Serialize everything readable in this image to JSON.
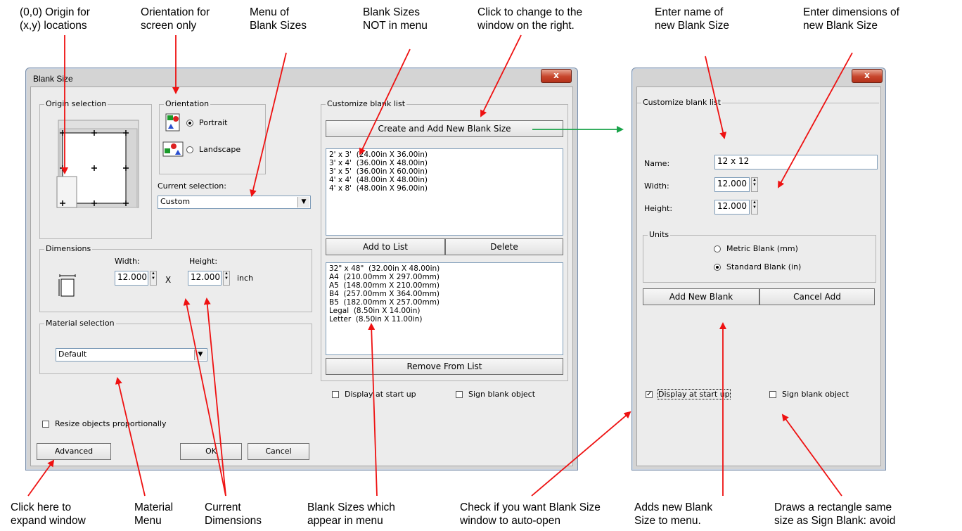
{
  "annotations_top": {
    "origin": "(0,0) Origin for\n(x,y) locations",
    "orientation": "Orientation for\nscreen only",
    "menu": "Menu of\nBlank Sizes",
    "not_in_menu": "Blank Sizes\nNOT in menu",
    "click_change": "Click to change to the\nwindow on the right.",
    "enter_name": "Enter name of\nnew Blank Size",
    "enter_dims": "Enter dimensions of\nnew Blank Size"
  },
  "annotations_bottom": {
    "expand": "Click here to\nexpand window",
    "material": "Material\nMenu",
    "current_dims": "Current\nDimensions",
    "in_menu": "Blank Sizes which\nappear in menu",
    "auto_open": "Check if you want Blank Size\nwindow to auto-open",
    "adds_new": "Adds new Blank\nSize to menu.",
    "draws_rect": "Draws a rectangle same\nsize as Sign Blank: avoid"
  },
  "dialog": {
    "title": "Blank Size",
    "close": "x",
    "origin_group": "Origin selection",
    "orientation_group": "Orientation",
    "portrait": "Portrait",
    "landscape": "Landscape",
    "current_selection_label": "Current selection:",
    "current_selection_value": "Custom",
    "dimensions_group": "Dimensions",
    "width_label": "Width:",
    "height_label": "Height:",
    "width_value": "12.000",
    "height_value": "12.000",
    "times": "X",
    "unit": "inch",
    "material_group": "Material selection",
    "material_value": "Default",
    "resize_label": "Resize objects proportionally",
    "advanced": "Advanced",
    "ok": "OK",
    "cancel": "Cancel",
    "customize_group": "Customize blank list",
    "create_button": "Create and Add New Blank Size",
    "menu_list": [
      "2' x 3'  (24.00in X 36.00in)",
      "3' x 4'  (36.00in X 48.00in)",
      "3' x 5'  (36.00in X 60.00in)",
      "4' x 4'  (48.00in X 48.00in)",
      "4' x 8'  (48.00in X 96.00in)"
    ],
    "add_to_list": "Add to List",
    "delete": "Delete",
    "other_list": [
      "32\" x 48\"  (32.00in X 48.00in)",
      "A4  (210.00mm X 297.00mm)",
      "A5  (148.00mm X 210.00mm)",
      "B4  (257.00mm X 364.00mm)",
      "B5  (182.00mm X 257.00mm)",
      "Legal  (8.50in X 14.00in)",
      "Letter  (8.50in X 11.00in)"
    ],
    "remove_from_list": "Remove From List",
    "display_startup": "Display at start up",
    "sign_blank": "Sign blank object"
  },
  "right_dialog": {
    "close": "x",
    "customize_group": "Customize blank list",
    "name_label": "Name:",
    "name_value": "12 x 12",
    "width_label": "Width:",
    "width_value": "12.000",
    "height_label": "Height:",
    "height_value": "12.000",
    "units_group": "Units",
    "metric": "Metric Blank (mm)",
    "standard": "Standard Blank (in)",
    "add_new_blank": "Add New Blank",
    "cancel_add": "Cancel Add",
    "display_startup": "Display at start up",
    "sign_blank": "Sign blank object",
    "display_checked": "✓"
  },
  "colors": {
    "arrow_red": "#ee1111",
    "arrow_green": "#1aa34a"
  }
}
